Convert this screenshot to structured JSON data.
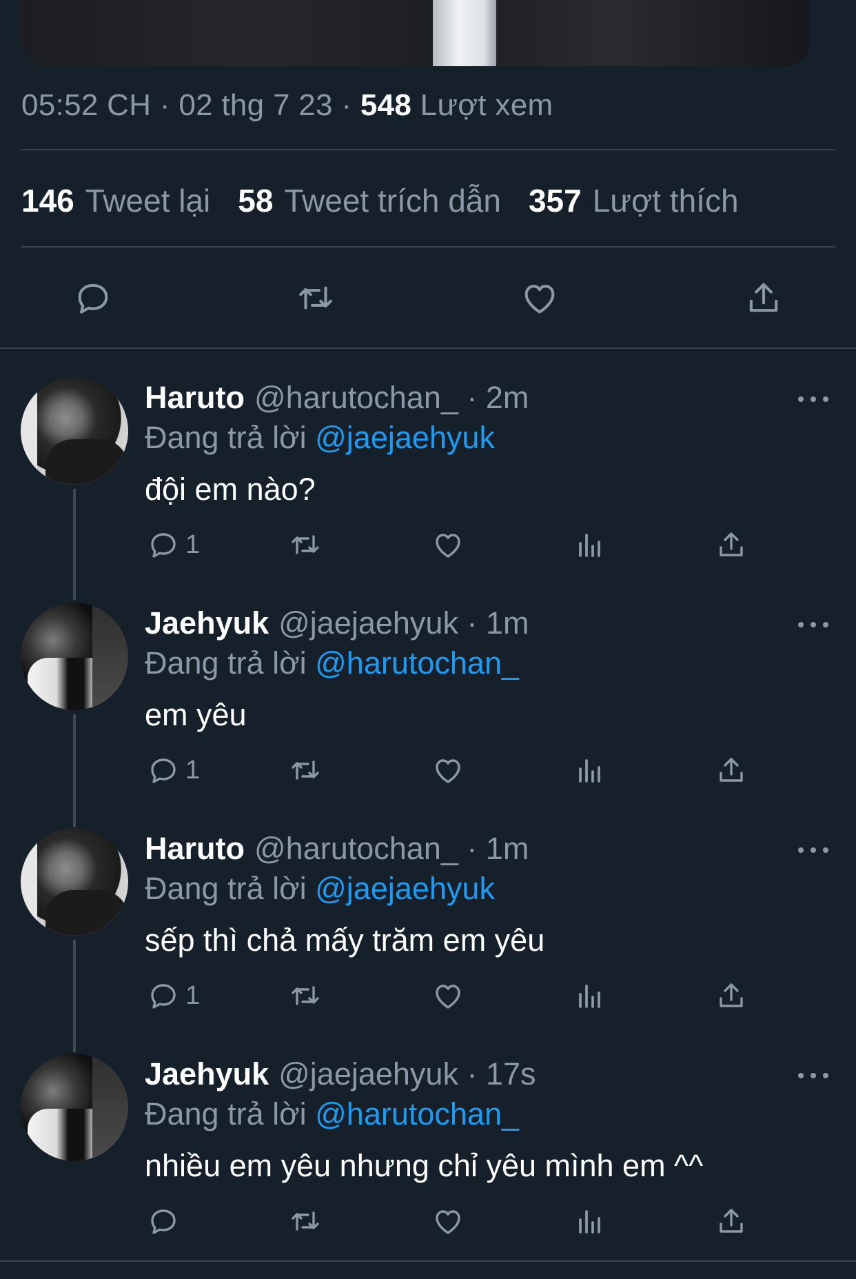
{
  "tweet": {
    "time": "05:52 CH",
    "date": "02 thg 7 23",
    "views_count": "548",
    "views_label": "Lượt xem",
    "separator": "·",
    "stats": {
      "retweets_count": "146",
      "retweets_label": "Tweet lại",
      "quotes_count": "58",
      "quotes_label": "Tweet trích dẫn",
      "likes_count": "357",
      "likes_label": "Lượt thích"
    },
    "actions": [
      "reply-icon",
      "retweet-icon",
      "like-icon",
      "share-icon"
    ]
  },
  "replies": [
    {
      "name": "Haruto",
      "handle": "@harutochan_",
      "time": "· 2m",
      "replying_prefix": "Đang trả lời",
      "replying_to": "@jaejaehyuk",
      "text": "đội em nào?",
      "reply_count": "1"
    },
    {
      "name": "Jaehyuk",
      "handle": "@jaejaehyuk",
      "time": "· 1m",
      "replying_prefix": "Đang trả lời",
      "replying_to": "@harutochan_",
      "text": "em yêu",
      "reply_count": "1"
    },
    {
      "name": "Haruto",
      "handle": "@harutochan_",
      "time": "· 1m",
      "replying_prefix": "Đang trả lời",
      "replying_to": "@jaejaehyuk",
      "text": "sếp thì chả mấy trăm em yêu",
      "reply_count": "1"
    },
    {
      "name": "Jaehyuk",
      "handle": "@jaejaehyuk",
      "time": "· 17s",
      "replying_prefix": "Đang trả lời",
      "replying_to": "@harutochan_",
      "text": "nhiều em yêu nhưng chỉ yêu mình em ^^",
      "reply_count": ""
    }
  ],
  "colors": {
    "background": "#15202b",
    "secondary_text": "#8b98a5",
    "mention": "#1d9bf0",
    "divider": "#38444d"
  }
}
